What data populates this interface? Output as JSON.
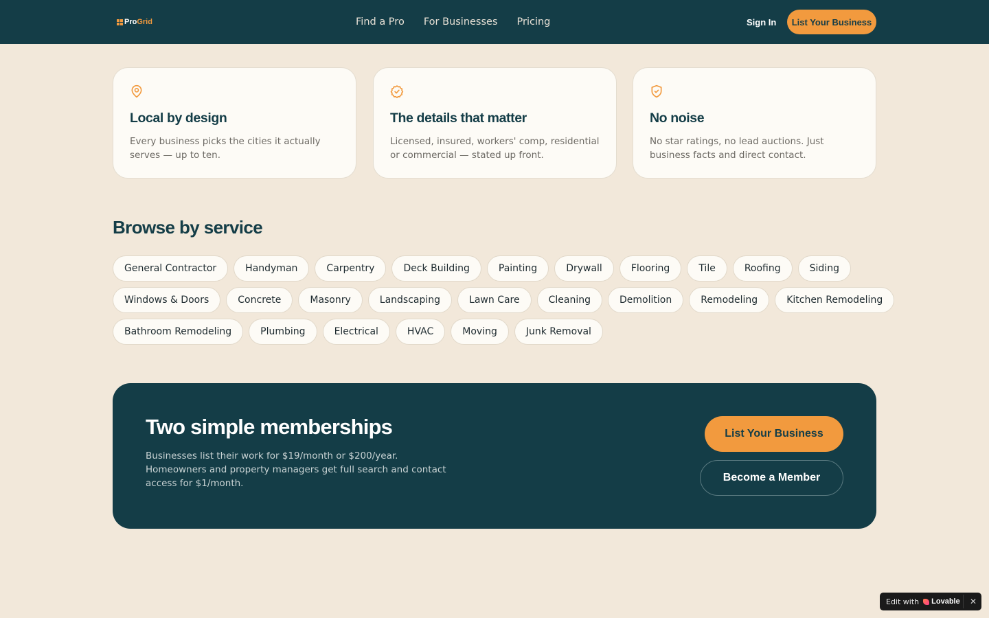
{
  "header": {
    "logo_part1": "Pro",
    "logo_part2": "Grid",
    "nav": [
      "Find a Pro",
      "For Businesses",
      "Pricing"
    ],
    "sign_in_label": "Sign In",
    "cta_label": "List Your Business"
  },
  "features": [
    {
      "icon": "map-pin-icon",
      "title": "Local by design",
      "description": "Every business picks the cities it actually serves — up to ten."
    },
    {
      "icon": "badge-check-icon",
      "title": "The details that matter",
      "description": "Licensed, insured, workers' comp, residential or commercial — stated up front."
    },
    {
      "icon": "shield-check-icon",
      "title": "No noise",
      "description": "No star ratings, no lead auctions. Just business facts and direct contact."
    }
  ],
  "browse": {
    "title": "Browse by service",
    "services": [
      "General Contractor",
      "Handyman",
      "Carpentry",
      "Deck Building",
      "Painting",
      "Drywall",
      "Flooring",
      "Tile",
      "Roofing",
      "Siding",
      "Windows & Doors",
      "Concrete",
      "Masonry",
      "Landscaping",
      "Lawn Care",
      "Cleaning",
      "Demolition",
      "Remodeling",
      "Kitchen Remodeling",
      "Bathroom Remodeling",
      "Plumbing",
      "Electrical",
      "HVAC",
      "Moving",
      "Junk Removal"
    ]
  },
  "membership": {
    "title": "Two simple memberships",
    "description": "Businesses list their work for $19/month or $200/year. Homeowners and property managers get full search and contact access for $1/month.",
    "primary_label": "List Your Business",
    "secondary_label": "Become a Member"
  },
  "badge": {
    "prefix": "Edit with",
    "brand": "Lovable",
    "close": "✕"
  },
  "colors": {
    "navy": "#143d47",
    "orange": "#f29a3e",
    "background": "#f2e8da",
    "card": "#fdfbf6"
  }
}
